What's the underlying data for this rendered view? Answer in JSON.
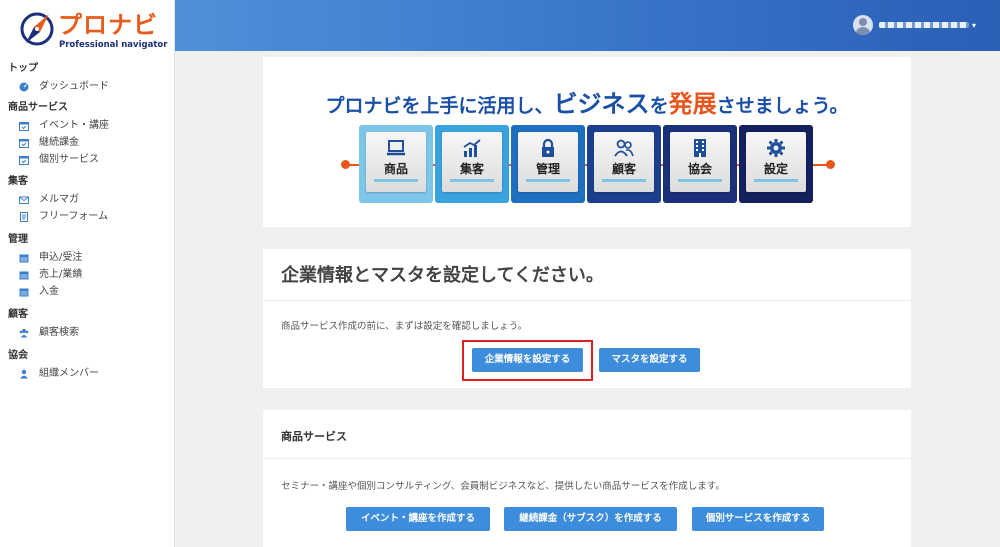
{
  "brand": {
    "name": "プロナビ",
    "subtitle": "Professional navigator",
    "primary_color": "#2a5fb6",
    "accent_color": "#e8551d"
  },
  "sidebar": {
    "groups": [
      {
        "title": "トップ",
        "items": [
          {
            "label": "ダッシュボード",
            "icon": "dashboard-icon"
          }
        ]
      },
      {
        "title": "商品サービス",
        "items": [
          {
            "label": "イベント・講座",
            "icon": "calendar-check-icon"
          },
          {
            "label": "継続課金",
            "icon": "calendar-check-icon"
          },
          {
            "label": "個別サービス",
            "icon": "calendar-check-icon"
          }
        ]
      },
      {
        "title": "集客",
        "items": [
          {
            "label": "メルマガ",
            "icon": "mail-icon"
          },
          {
            "label": "フリーフォーム",
            "icon": "form-icon"
          }
        ]
      },
      {
        "title": "管理",
        "items": [
          {
            "label": "申込/受注",
            "icon": "calendar-icon"
          },
          {
            "label": "売上/業績",
            "icon": "calendar-icon"
          },
          {
            "label": "入金",
            "icon": "calendar-icon"
          }
        ]
      },
      {
        "title": "顧客",
        "items": [
          {
            "label": "顧客検索",
            "icon": "users-icon"
          }
        ]
      },
      {
        "title": "協会",
        "items": [
          {
            "label": "組織メンバー",
            "icon": "user-icon"
          }
        ]
      }
    ]
  },
  "header": {
    "user_caret": "▾"
  },
  "banner": {
    "title_part1": "プロナビを上手に活用し、",
    "title_part2": "ビジネス",
    "title_part3": "を",
    "title_part4": "発展",
    "title_part5": "させましょう。",
    "steps": [
      {
        "label": "商品",
        "icon": "laptop-icon",
        "color": "#7ec5ea",
        "style": "solid"
      },
      {
        "label": "集客",
        "icon": "chart-icon",
        "color": "#3aa3de",
        "style": "solid"
      },
      {
        "label": "管理",
        "icon": "lock-icon",
        "color": "#1f6fc0",
        "style": "solid"
      },
      {
        "label": "顧客",
        "icon": "people-icon",
        "color": "#1c3f8f",
        "style": "solid"
      },
      {
        "label": "協会",
        "icon": "building-icon",
        "color": "#1b2f7a",
        "style": "solid"
      },
      {
        "label": "設定",
        "icon": "gear-icon",
        "color": "#141f5e",
        "style": "solid"
      }
    ]
  },
  "setup": {
    "title": "企業情報とマスタを設定してください。",
    "description": "商品サービス作成の前に、まずは設定を確認しましょう。",
    "company_button": "企業情報を設定する",
    "master_button": "マスタを設定する"
  },
  "service": {
    "title": "商品サービス",
    "description": "セミナー・講座や個別コンサルティング、会員制ビジネスなど、提供したい商品サービスを作成します。",
    "event_button": "イベント・講座を作成する",
    "subscription_button": "継続課金（サブスク）を作成する",
    "individual_button": "個別サービスを作成する"
  }
}
